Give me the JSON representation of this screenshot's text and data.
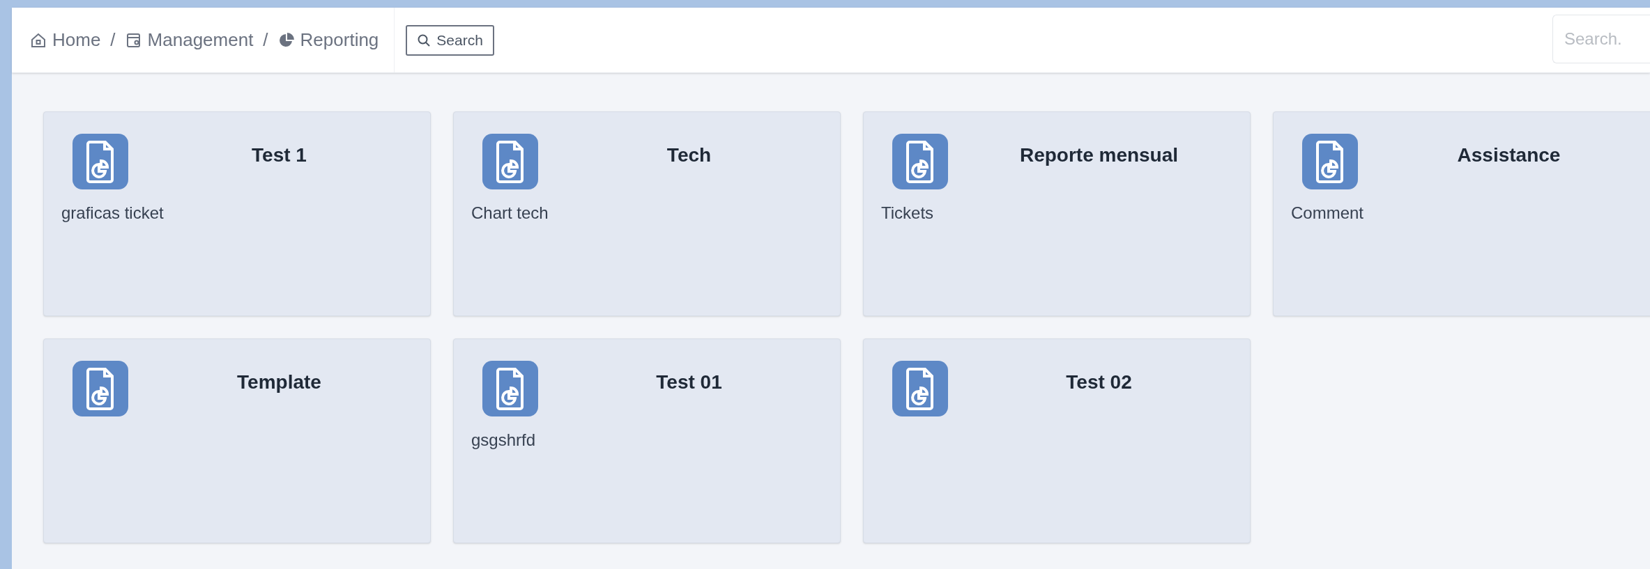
{
  "breadcrumb": [
    {
      "label": "Home",
      "kind": "home"
    },
    {
      "label": "Management",
      "kind": "section"
    },
    {
      "label": "Reporting",
      "kind": "report"
    }
  ],
  "breadcrumb_separator": "/",
  "search_button": {
    "label": "Search"
  },
  "search_field": {
    "placeholder": "Search."
  },
  "reports": [
    {
      "title": "Test 1",
      "description": "graficas ticket"
    },
    {
      "title": "Tech",
      "description": "Chart tech"
    },
    {
      "title": "Reporte mensual",
      "description": "Tickets"
    },
    {
      "title": "Assistance",
      "description": "Comment"
    },
    {
      "title": "Template"
    },
    {
      "title": "Test 01",
      "description": "gsgshrfd"
    },
    {
      "title": "Test 02"
    }
  ]
}
